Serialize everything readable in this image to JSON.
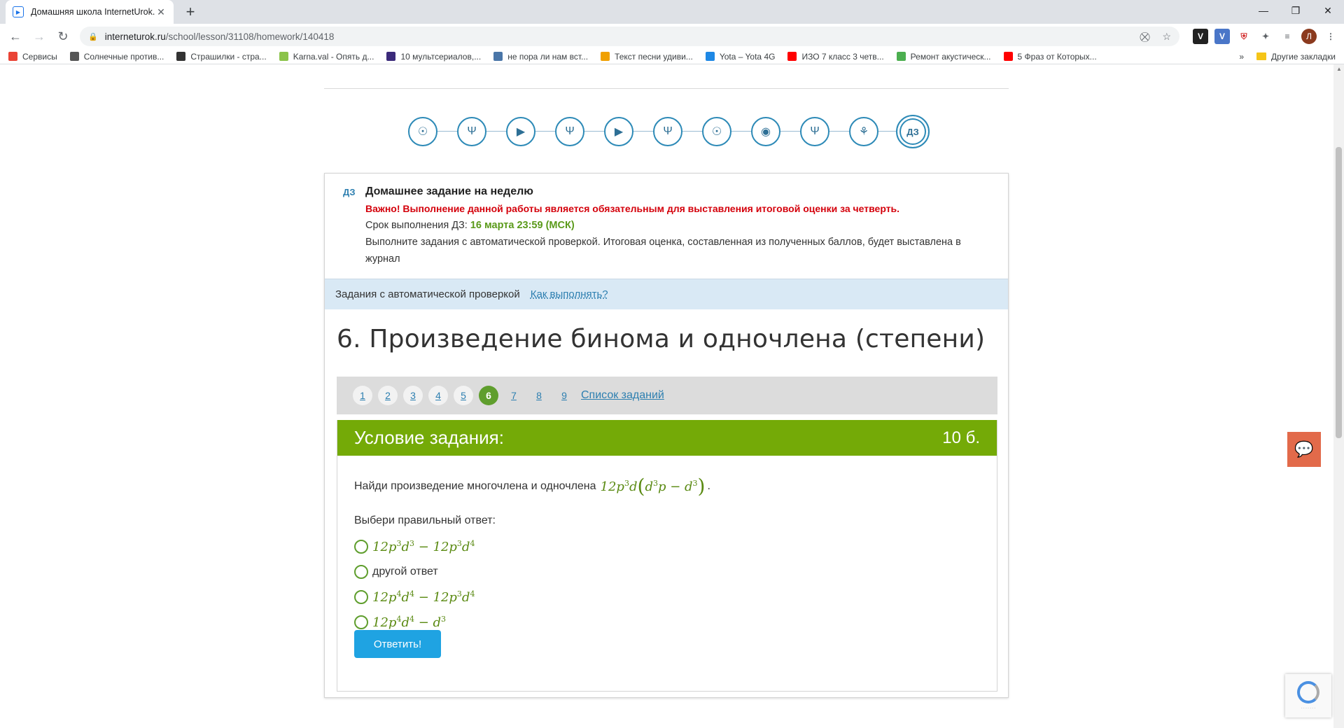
{
  "browser": {
    "tab_title": "Домашняя школа InternetUrok.r",
    "url_host": "interneturok.ru",
    "url_path": "/school/lesson/31108/homework/140418",
    "avatar_letter": "Л",
    "bookmarks": [
      {
        "label": "Сервисы",
        "color": "#ea4335"
      },
      {
        "label": "Солнечные против...",
        "color": "#555555"
      },
      {
        "label": "Страшилки - стра...",
        "color": "#333333"
      },
      {
        "label": "Karna.val - Опять д...",
        "color": "#8bc34a"
      },
      {
        "label": "10 мультсериалов,...",
        "color": "#3b2a7a"
      },
      {
        "label": "не пора ли нам вст...",
        "color": "#4a76a8"
      },
      {
        "label": "Текст песни удиви...",
        "color": "#f0a000"
      },
      {
        "label": "Yota – Yota 4G",
        "color": "#1e88e5"
      },
      {
        "label": "ИЗО 7 класс 3 четв...",
        "color": "#ff0000"
      },
      {
        "label": "Ремонт акустическ...",
        "color": "#4caf50"
      },
      {
        "label": "5 Фраз от Которых...",
        "color": "#ff0000"
      }
    ],
    "other_bookmarks": "Другие закладки"
  },
  "steps": [
    {
      "icon": "lightbulb-icon",
      "glyph": "☉"
    },
    {
      "icon": "dumbbell-icon",
      "glyph": "Ψ"
    },
    {
      "icon": "play-icon",
      "glyph": "▶"
    },
    {
      "icon": "dumbbell-icon",
      "glyph": "Ψ"
    },
    {
      "icon": "play-icon",
      "glyph": "▶"
    },
    {
      "icon": "dumbbell-icon",
      "glyph": "Ψ"
    },
    {
      "icon": "lightbulb-icon",
      "glyph": "☉"
    },
    {
      "icon": "webcam-icon",
      "glyph": "◉"
    },
    {
      "icon": "dumbbell-icon",
      "glyph": "Ψ"
    },
    {
      "icon": "bicycle-icon",
      "glyph": "⚘"
    },
    {
      "icon": "homework-icon",
      "glyph": "ДЗ"
    }
  ],
  "homework": {
    "tag": "ДЗ",
    "title": "Домашнее задание на неделю",
    "important": "Важно! Выполнение данной работы является обязательным для выставления итоговой оценки за четверть.",
    "deadline_label": "Срок выполнения ДЗ:",
    "deadline_value": "16 марта 23:59 (МСК)",
    "description": "Выполните задания с автоматической проверкой. Итоговая оценка, составленная из полученных баллов, будет выставлена в журнал"
  },
  "autocheck": {
    "label": "Задания с автоматической проверкой",
    "howto": "Как выполнять?"
  },
  "task": {
    "title": "6. Произведение бинома и одночлена (степени)",
    "pages": [
      "1",
      "2",
      "3",
      "4",
      "5",
      "6",
      "7",
      "8",
      "9"
    ],
    "current_page": 6,
    "list_link": "Список заданий",
    "condition_label": "Условие задания:",
    "points": "10 б.",
    "question": "Найди произведение многочлена и одночлена",
    "choose_label": "Выбери правильный ответ:",
    "options": [
      {
        "type": "math",
        "id": "opt1"
      },
      {
        "type": "text",
        "text": "другой ответ"
      },
      {
        "type": "math",
        "id": "opt3"
      },
      {
        "type": "math",
        "id": "opt4"
      }
    ],
    "submit": "Ответить!"
  },
  "colors": {
    "accent_green": "#74aa07",
    "link_blue": "#2d7fb0",
    "submit_blue": "#1fa3e2",
    "important_red": "#d4000b"
  }
}
